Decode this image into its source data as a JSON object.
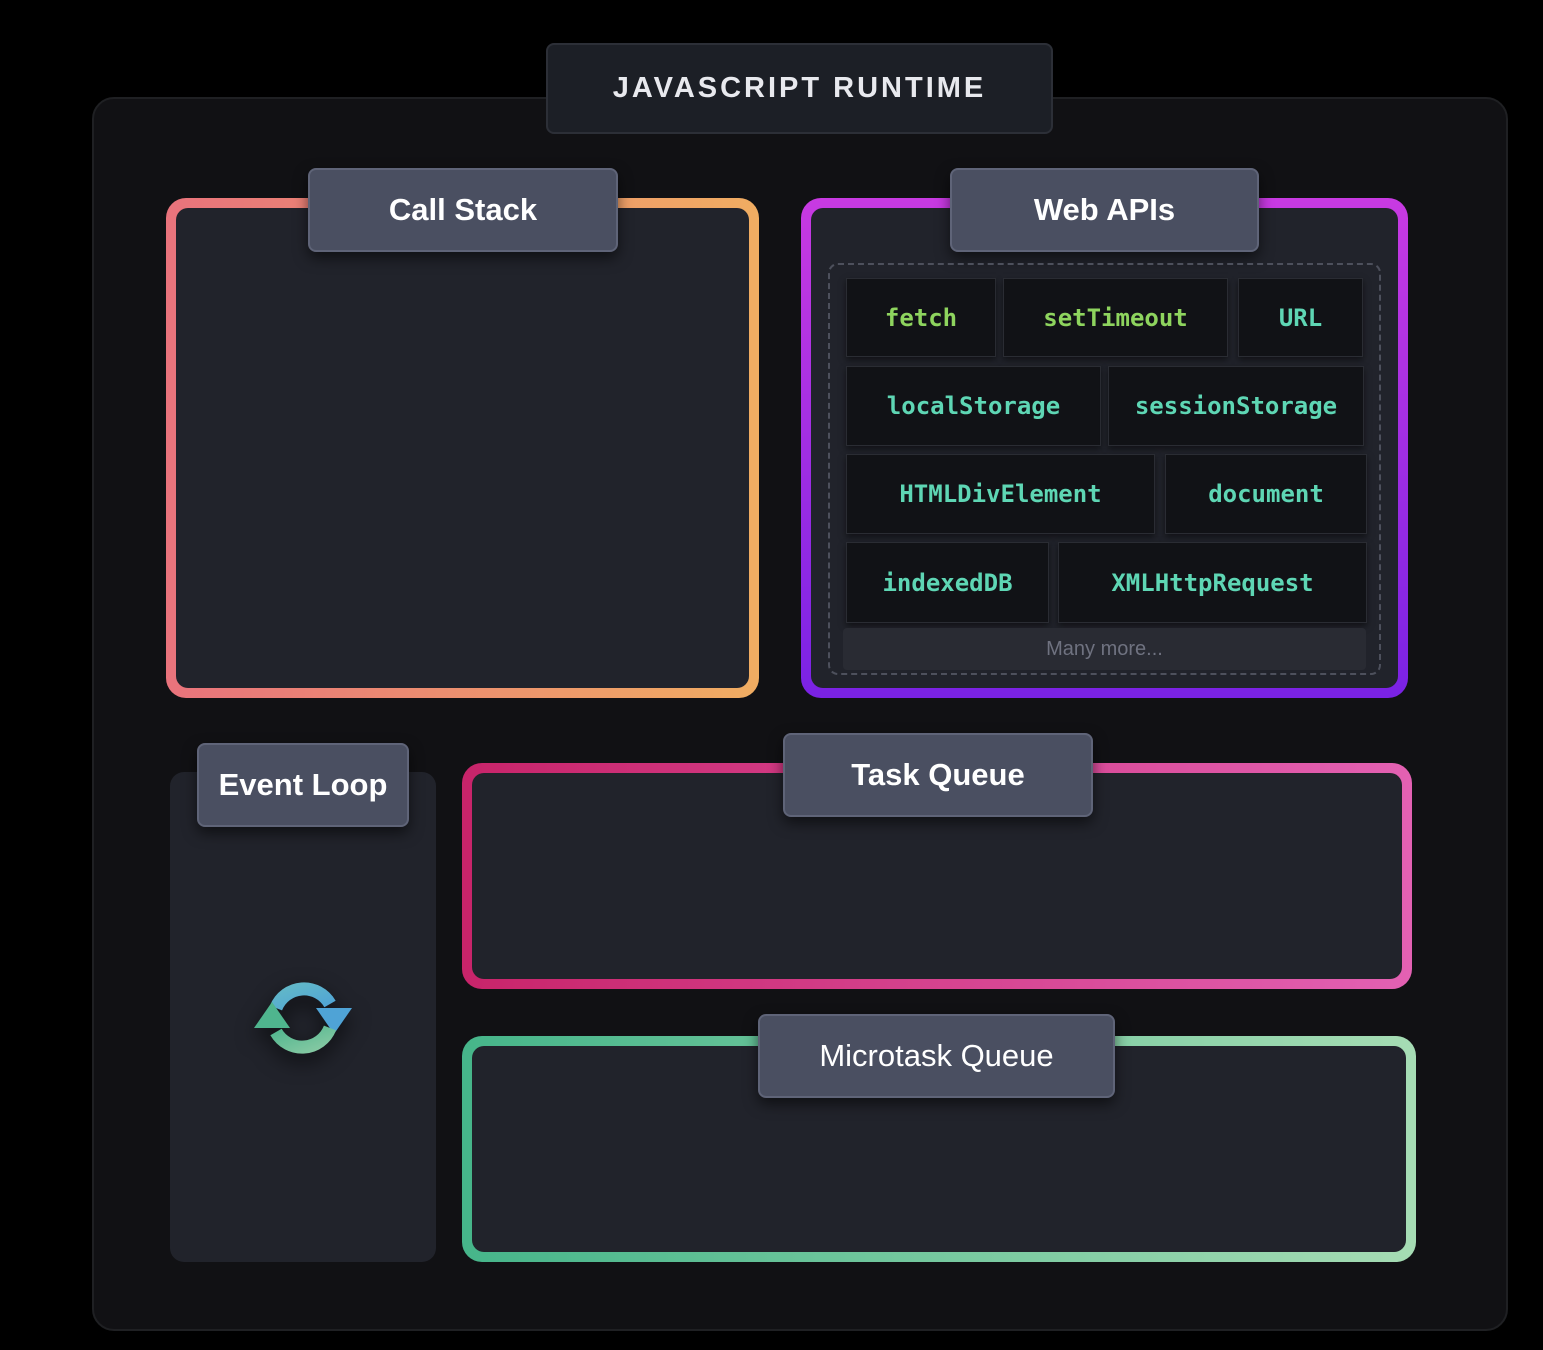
{
  "runtime": {
    "title": "JAVASCRIPT RUNTIME"
  },
  "call_stack": {
    "label": "Call Stack"
  },
  "web_apis": {
    "label": "Web APIs",
    "items": [
      "fetch",
      "setTimeout",
      "URL",
      "localStorage",
      "sessionStorage",
      "HTMLDivElement",
      "document",
      "indexedDB",
      "XMLHttpRequest"
    ],
    "more": "Many more..."
  },
  "event_loop": {
    "label": "Event Loop",
    "icon": "refresh-icon"
  },
  "task_queue": {
    "label": "Task Queue"
  },
  "microtask_queue": {
    "label": "Microtask Queue"
  },
  "colors": {
    "call_stack_border": [
      "#e9737c",
      "#f0ad62"
    ],
    "web_apis_border": [
      "#c83ae2",
      "#7a22e4"
    ],
    "task_queue_border": [
      "#c8246a",
      "#e361b3"
    ],
    "microtask_queue_border": [
      "#46b58a",
      "#a6dcb4"
    ],
    "api_text_green": "#8ed45e",
    "api_text_teal": "#5ed6b4"
  }
}
